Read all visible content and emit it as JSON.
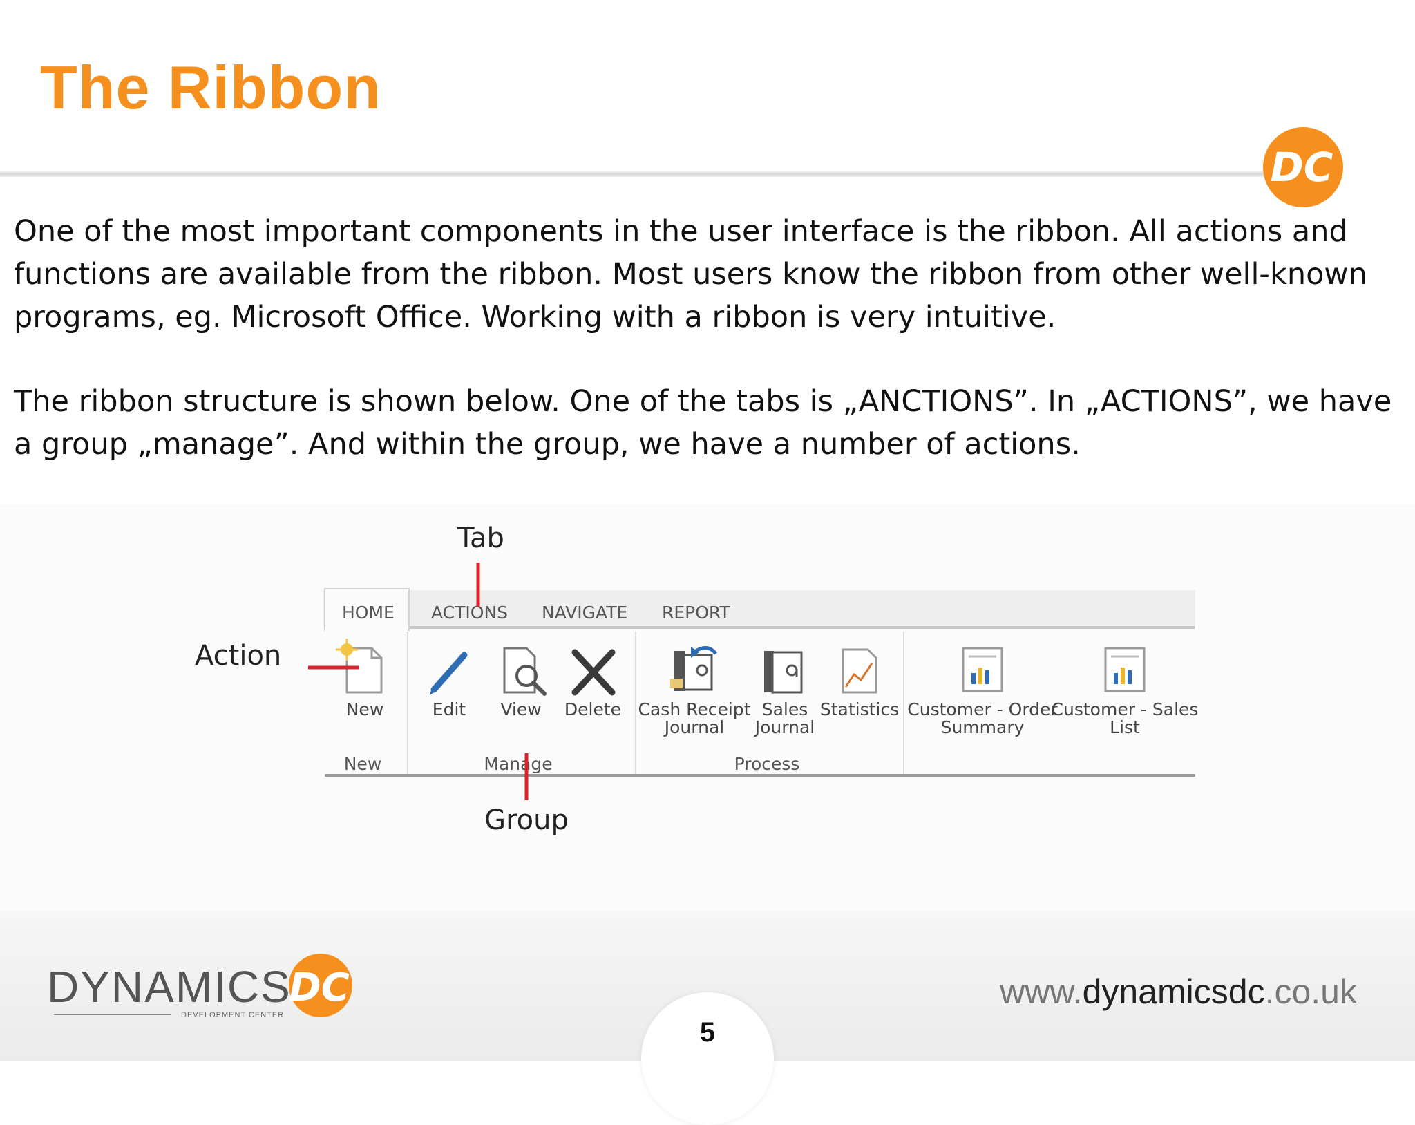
{
  "slide": {
    "title": "The Ribbon",
    "paragraph_1": "One of the most important components in the user interface is the ribbon.  All actions and functions are available from the ribbon.  Most users know the ribbon from other well-known programs, eg. Microsoft Office.  Working with a ribbon is very intuitive.",
    "paragraph_2": "The ribbon structure is shown below. One of the tabs is „ANCTIONS”.  In „ACTIONS”, we have a group „manage”. And within the group, we have a number of actions.",
    "badge_text": "DC",
    "accent_color": "#f5901e",
    "annotation_color": "#d9242b"
  },
  "ribbon": {
    "tabs": [
      {
        "label": "HOME",
        "selected": true
      },
      {
        "label": "ACTIONS",
        "selected": false
      },
      {
        "label": "NAVIGATE",
        "selected": false
      },
      {
        "label": "REPORT",
        "selected": false
      }
    ],
    "actions": [
      {
        "label_line1": "New",
        "label_line2": "",
        "icon": "new-document-icon"
      },
      {
        "label_line1": "Edit",
        "label_line2": "",
        "icon": "pencil-icon"
      },
      {
        "label_line1": "View",
        "label_line2": "",
        "icon": "view-magnifier-icon"
      },
      {
        "label_line1": "Delete",
        "label_line2": "",
        "icon": "delete-x-icon"
      },
      {
        "label_line1": "Cash Receipt",
        "label_line2": "Journal",
        "icon": "cash-receipt-journal-icon"
      },
      {
        "label_line1": "Sales",
        "label_line2": "Journal",
        "icon": "sales-journal-icon"
      },
      {
        "label_line1": "Statistics",
        "label_line2": "",
        "icon": "statistics-icon"
      },
      {
        "label_line1": "Customer - Order",
        "label_line2": "Summary",
        "icon": "report-icon"
      },
      {
        "label_line1": "Customer - Sales",
        "label_line2": "List",
        "icon": "report-icon"
      }
    ],
    "groups": [
      "New",
      "Manage",
      "Process"
    ],
    "callouts": {
      "tab": "Tab",
      "action": "Action",
      "group": "Group"
    }
  },
  "footer": {
    "brand_name": "DYNAMICS",
    "brand_badge": "DC",
    "brand_sub": "DEVELOPMENT CENTER",
    "website_prefix": "www.",
    "website_mid": "dynamicsdc",
    "website_suffix": ".co.uk",
    "page_number": "5"
  }
}
